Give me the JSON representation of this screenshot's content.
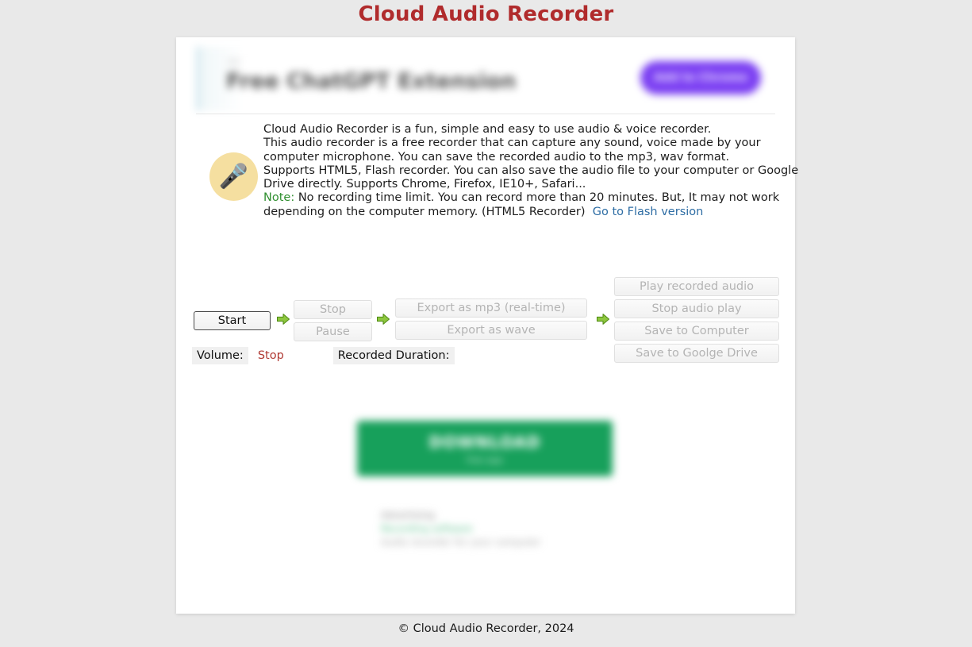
{
  "page": {
    "title": "Cloud Audio Recorder",
    "title_color": "#b02b2c",
    "background_color": "#e9e9e9",
    "card_background": "#ffffff"
  },
  "ad_banner": {
    "eyebrow": "AD",
    "headline": "Free ChatGPT Extension",
    "cta_label": "Add to Chrome",
    "cta_color": "#7b3ff2",
    "blurred": "true"
  },
  "description": {
    "icon": "microphone-icon",
    "icon_glyph": "🎤",
    "icon_background": "#f5dfa0",
    "lines": [
      "Cloud Audio Recorder is a fun, simple and easy to use audio & voice recorder.",
      "This audio recorder is a free recorder that can capture any sound, voice made by your",
      "computer microphone. You can save the recorded audio to the mp3, wav format.",
      "Supports HTML5, Flash recorder. You can also save the audio file to your computer or Google",
      "Drive directly. Supports Chrome, Firefox, IE10+, Safari..."
    ],
    "note_label": "Note:",
    "note_label_color": "#2f8f2f",
    "note_line_1": " No recording time limit. You can record more than 20 minutes. But, It may not work",
    "note_line_2": "depending on the computer memory. (HTML5 Recorder)",
    "flash_link": "Go to Flash version",
    "flash_link_color": "#2e6da4"
  },
  "controls": {
    "arrow_icon": "green-right-arrow-icon",
    "arrow_color": "#6ab023",
    "group_start": {
      "buttons": [
        {
          "label": "Start",
          "state": "enabled"
        }
      ]
    },
    "group_stop_pause": {
      "buttons": [
        {
          "label": "Stop",
          "state": "disabled"
        },
        {
          "label": "Pause",
          "state": "disabled"
        }
      ]
    },
    "group_export": {
      "buttons": [
        {
          "label": "Export as mp3 (real-time)",
          "state": "disabled"
        },
        {
          "label": "Export as wave",
          "state": "disabled"
        }
      ]
    },
    "group_play_save": {
      "buttons": [
        {
          "label": "Play recorded audio",
          "state": "disabled"
        },
        {
          "label": "Stop audio play",
          "state": "disabled"
        },
        {
          "label": "Save to Computer",
          "state": "disabled"
        },
        {
          "label": "Save to Goolge Drive",
          "state": "disabled"
        }
      ]
    }
  },
  "status": {
    "volume_label": "Volume:",
    "volume_value": "Stop",
    "volume_value_color": "#b03a34",
    "duration_label": "Recorded Duration:",
    "duration_value": ""
  },
  "promo_download": {
    "main_label": "DOWNLOAD",
    "sub_label": "free app",
    "color": "#17a05b",
    "blurred": "true"
  },
  "promo_text": {
    "title": "Advertising",
    "line_green": "Recording software",
    "line_dim": "Audio recorder for your computer",
    "blurred": "true"
  },
  "footer": {
    "text": "© Cloud Audio Recorder, 2024"
  }
}
